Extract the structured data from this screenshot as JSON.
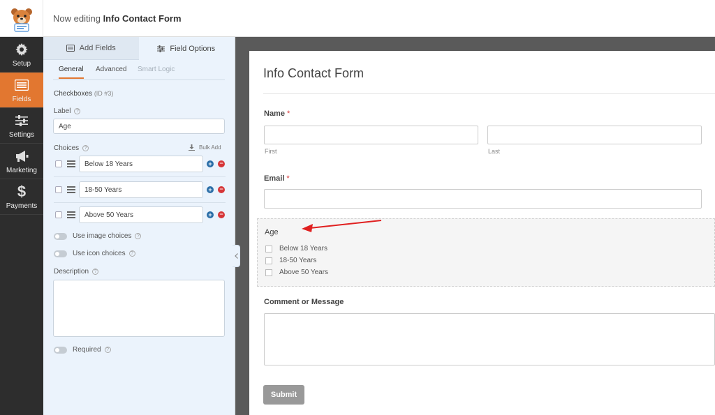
{
  "header": {
    "editing_prefix": "Now editing",
    "form_name": "Info Contact Form",
    "logo_icon": "bear-mascot-icon"
  },
  "nav": [
    {
      "label": "Setup",
      "icon": "gear-icon"
    },
    {
      "label": "Fields",
      "icon": "fields-list-icon",
      "active": true
    },
    {
      "label": "Settings",
      "icon": "sliders-icon"
    },
    {
      "label": "Marketing",
      "icon": "megaphone-icon"
    },
    {
      "label": "Payments",
      "icon": "dollar-icon"
    }
  ],
  "panel": {
    "tabs": [
      {
        "label": "Add Fields",
        "icon": "list-icon"
      },
      {
        "label": "Field Options",
        "icon": "sliders-icon",
        "active": true
      }
    ],
    "subtabs": [
      "General",
      "Advanced",
      "Smart Logic"
    ],
    "field_type": "Checkboxes",
    "field_id": "(ID #3)",
    "label_title": "Label",
    "label_value": "Age",
    "choices_title": "Choices",
    "bulk_add": "Bulk Add",
    "choices": [
      "Below 18 Years",
      "18-50 Years",
      "Above 50 Years"
    ],
    "use_image_choices": "Use image choices",
    "use_icon_choices": "Use icon choices",
    "description_title": "Description",
    "required_label": "Required"
  },
  "preview": {
    "title": "Info Contact Form",
    "name_label": "Name",
    "first_sublabel": "First",
    "last_sublabel": "Last",
    "email_label": "Email",
    "age_label": "Age",
    "age_options": [
      "Below 18 Years",
      "18-50 Years",
      "Above 50 Years"
    ],
    "comment_label": "Comment or Message",
    "submit_label": "Submit",
    "required_mark": "*"
  },
  "colors": {
    "accent": "#e27730",
    "nav_bg": "#2d2d2d",
    "panel_bg": "#ebf3fc",
    "annotation_arrow": "#e02020"
  }
}
